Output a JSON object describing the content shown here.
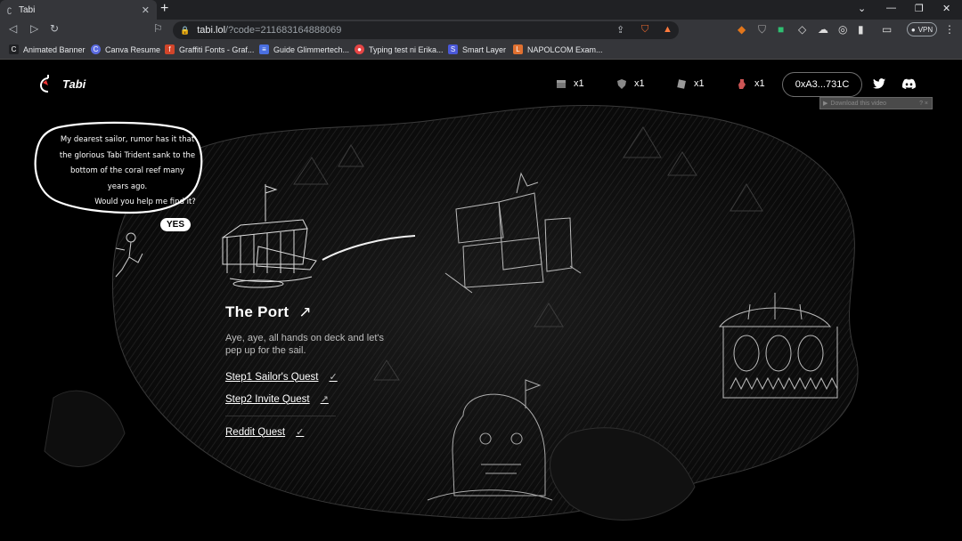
{
  "browser": {
    "tab_title": "Tabi",
    "url_host": "tabi.lol",
    "url_path": "/?code=211683164888069",
    "vpn_label": "VPN",
    "bookmarks": [
      {
        "label": "Animated Banner",
        "color": "#202124",
        "glyph": "C"
      },
      {
        "label": "Canva Resume",
        "color": "#5b6be0",
        "glyph": "C"
      },
      {
        "label": "Graffiti Fonts - Graf...",
        "color": "#d2452a",
        "glyph": "f"
      },
      {
        "label": "Guide Glimmertech...",
        "color": "#4a6fe0",
        "glyph": "≡"
      },
      {
        "label": "Typing test ni Erika...",
        "color": "#e54545",
        "glyph": "●"
      },
      {
        "label": "Smart Layer",
        "color": "#4a58d8",
        "glyph": "S"
      },
      {
        "label": "NAPOLCOM Exam...",
        "color": "#e07030",
        "glyph": "L"
      }
    ]
  },
  "header": {
    "logo_text": "Tabi",
    "inventory": [
      {
        "icon": "chest-icon",
        "count": "x1"
      },
      {
        "icon": "shield-icon",
        "count": "x1"
      },
      {
        "icon": "scroll-icon",
        "count": "x1"
      },
      {
        "icon": "potion-icon",
        "count": "x1"
      }
    ],
    "wallet": "0xA3...731C",
    "download_label": "Download this video",
    "download_close": "? ×"
  },
  "bubble": {
    "lines": [
      "My dearest sailor, rumor has it that",
      "the glorious Tabi Trident sank to the",
      "bottom of the coral reef many",
      "years ago.",
      "Would you help me find it?"
    ],
    "yes_label": "YES"
  },
  "port": {
    "title": "The Port",
    "description": "Aye, aye, all hands on deck and let's pep up for the sail.",
    "quests": [
      {
        "label": "Step1 Sailor's Quest",
        "status": "✓"
      },
      {
        "label": "Step2 Invite Quest",
        "status": "↗"
      },
      {
        "label": "Reddit Quest",
        "status": "✓"
      }
    ]
  },
  "colors": {
    "accent": "#ffffff",
    "background": "#000000",
    "tab_bg": "#35363a"
  }
}
